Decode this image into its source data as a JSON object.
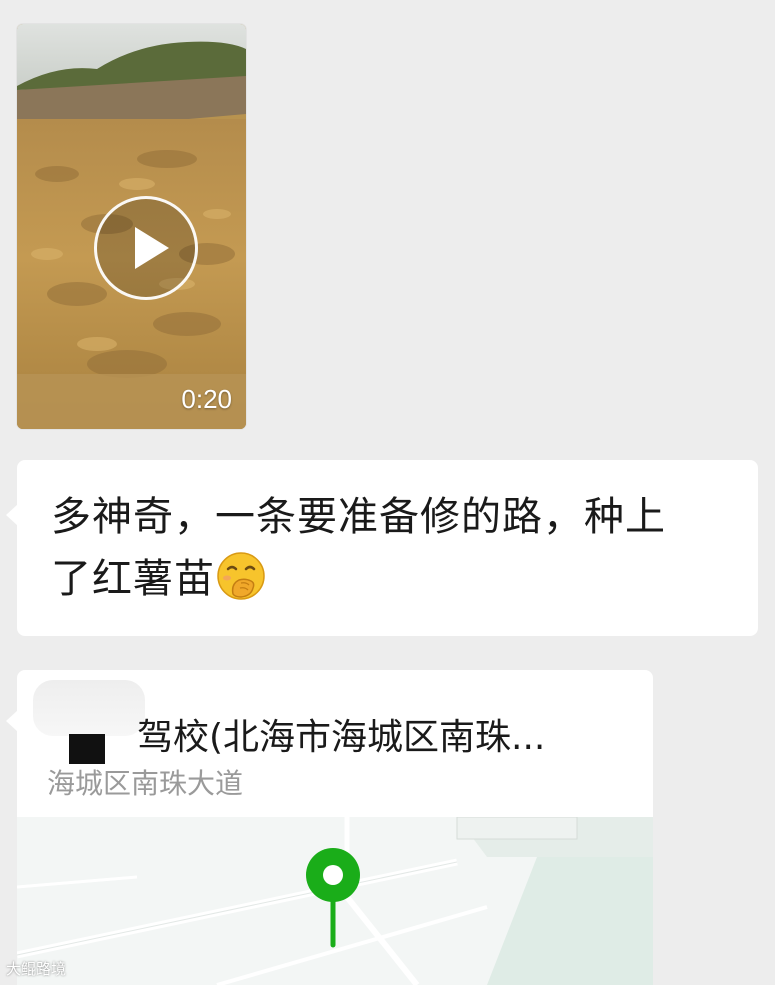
{
  "messages": {
    "video": {
      "duration": "0:20",
      "thumb_colors": [
        "#c9a45e",
        "#a47c3a",
        "#6f7d3f"
      ]
    },
    "text": {
      "line1": "多神奇，一条要准备修的路，种上",
      "line2": "了红薯苗",
      "emoji": "face-with-hand-over-mouth"
    },
    "location": {
      "title": "驾校(北海市海城区南珠...",
      "address": "海城区南珠大道",
      "pin_color": "#1aad19"
    }
  },
  "watermark": {
    "text": "大鲲路境"
  },
  "colors": {
    "chat_background": "#ededed",
    "bubble": "#ffffff",
    "map_green": "#1aad19"
  }
}
